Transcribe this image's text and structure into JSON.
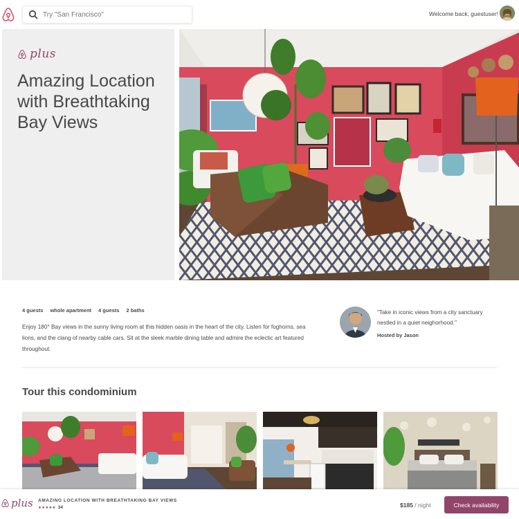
{
  "header": {
    "search_placeholder": "Try \"San Francisco\"",
    "welcome_text": "Welcome back, guestuser!"
  },
  "hero": {
    "plus_label": "plus",
    "title": "Amazing Location with Breathtaking Bay Views"
  },
  "listing": {
    "facts": [
      "4 guests",
      "whole apartment",
      "4 guests",
      "2 baths"
    ],
    "description": "Enjoy 180° Bay views in the sunny living room at this hidden oasis in the heart of the city. Listen for foghorns, sea lions, and the clang of nearby cable cars. Sit at the sleek marble dining table and admire the eclectic art featured throughout.",
    "host_quote": "\"Take in iconic views from a city sanctuary nestled in a quiet neighorhood.\"",
    "hosted_by": "Hosted by Jason"
  },
  "tour": {
    "title": "Tour this condominium"
  },
  "bottom_bar": {
    "plus_label": "plus",
    "listing_title": "AMAZING LOCATION WITH BREATHTAKING BAY VIEWS",
    "stars": "★★★★★",
    "review_count": "34",
    "price": "$185",
    "price_unit": " / night",
    "cta_label": "Check availability"
  },
  "colors": {
    "brand": "#914669",
    "text": "#484848",
    "panel_bg": "#efefef",
    "wall_red": "#d84a5c"
  },
  "icons": {
    "logo": "airbnb-belo-icon",
    "search": "search-icon"
  }
}
